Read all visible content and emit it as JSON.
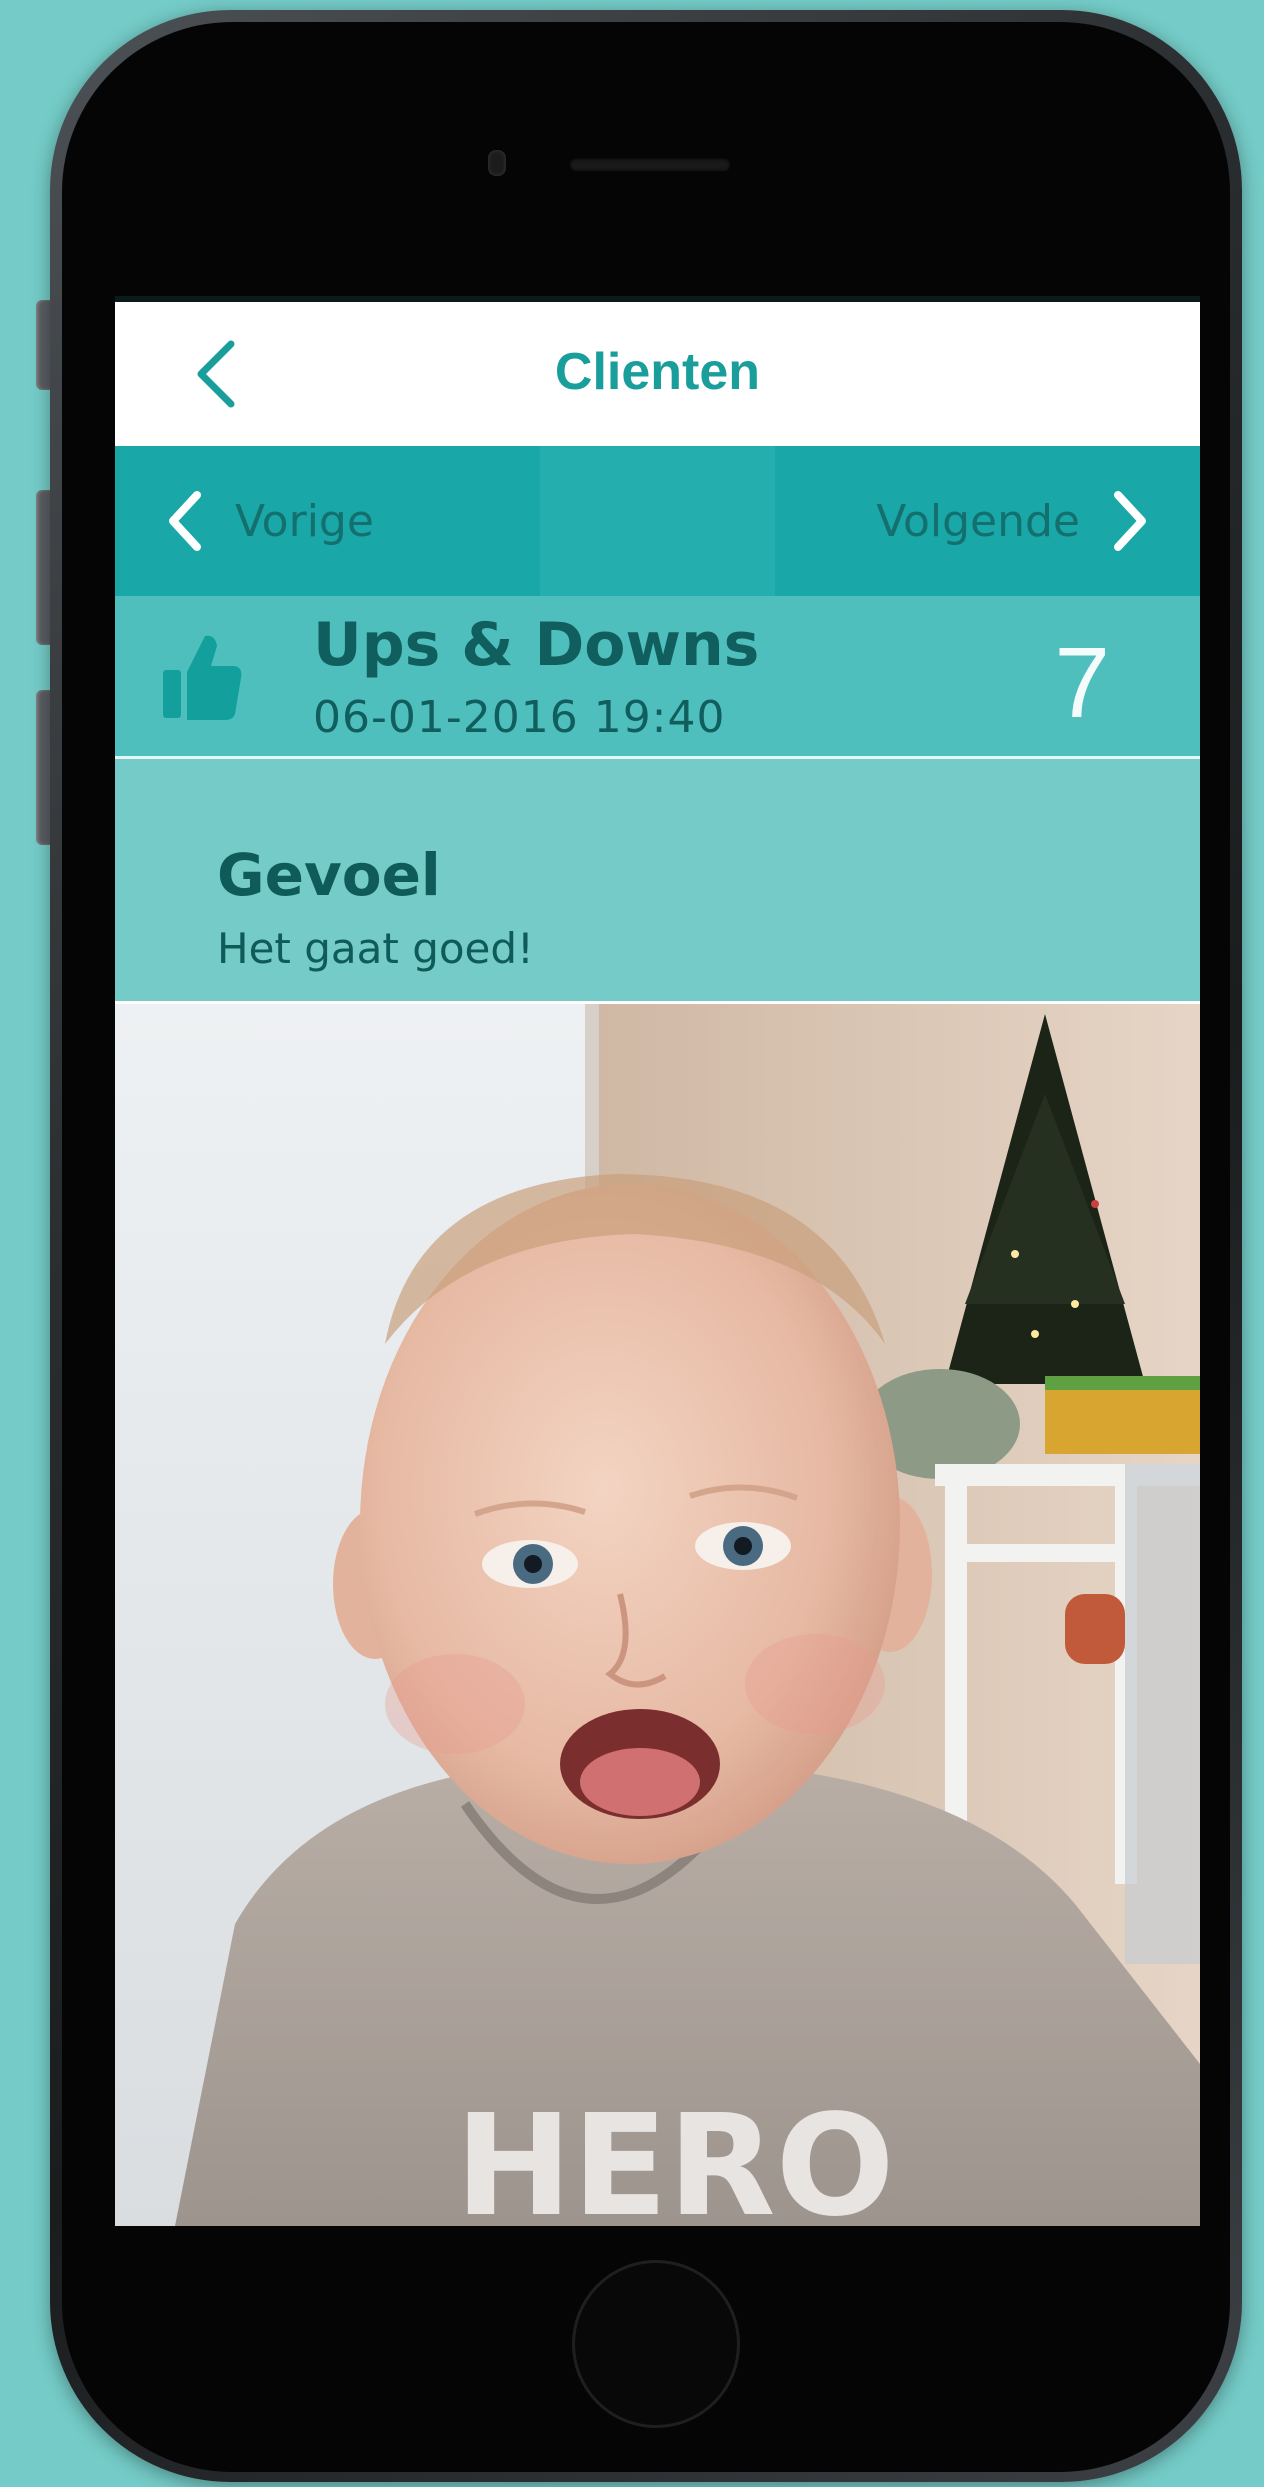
{
  "nav": {
    "title": "Clienten",
    "back_icon": "chevron-left-icon"
  },
  "pager": {
    "prev_label": "Vorige",
    "next_label": "Volgende",
    "prev_icon": "chevron-left-icon",
    "next_icon": "chevron-right-icon"
  },
  "entry": {
    "icon": "thumbs-up-icon",
    "title": "Ups & Downs",
    "date": "06-01-2016 19:40",
    "score": "7"
  },
  "detail": {
    "title": "Gevoel",
    "text": "Het gaat goed!"
  },
  "photo": {
    "subject": "photo"
  },
  "colors": {
    "accent": "#1a9e9c",
    "pager_bg": "#1aa7a7",
    "header_bg": "#4fbfbd",
    "detail_bg": "#74cbc7",
    "text_dark": "#105e5d"
  }
}
